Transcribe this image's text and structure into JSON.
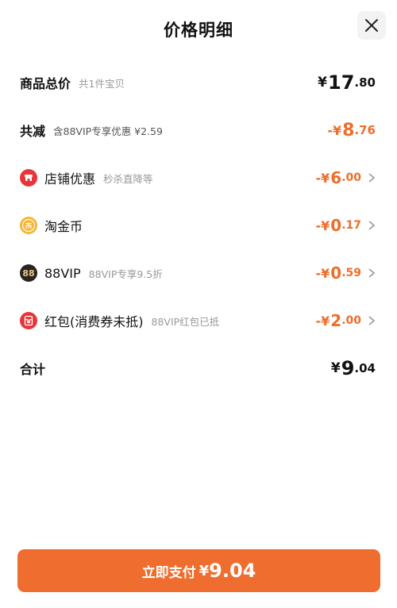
{
  "header": {
    "title": "价格明细",
    "close_icon": "close-icon"
  },
  "rows": {
    "total": {
      "label": "商品总价",
      "hint": "共1件宝贝",
      "currency": "¥",
      "int": "17",
      "dec": ".80"
    },
    "reduce": {
      "label": "共减",
      "hint": "含88VIP专享优惠 ¥2.59",
      "prefix": "-¥",
      "int": "8",
      "dec": ".76"
    },
    "shop": {
      "label": "店铺优惠",
      "hint": "秒杀直降等",
      "prefix": "-¥",
      "int": "6",
      "dec": ".00",
      "icon": "shop-icon"
    },
    "coin": {
      "label": "淘金币",
      "hint": "",
      "prefix": "-¥",
      "int": "0",
      "dec": ".17",
      "icon": "coin-icon"
    },
    "vip": {
      "label": "88VIP",
      "hint": "88VIP专享9.5折",
      "prefix": "-¥",
      "int": "0",
      "dec": ".59",
      "icon": "vip-icon",
      "icon_text": "88"
    },
    "redpacket": {
      "label": "红包(消费券未抵)",
      "hint": "88VIP红包已抵",
      "prefix": "-¥",
      "int": "2",
      "dec": ".00",
      "icon": "red-packet-icon"
    },
    "sum": {
      "label": "合计",
      "currency": "¥",
      "int": "9",
      "dec": ".04"
    }
  },
  "pay_button": {
    "label": "立即支付",
    "currency": "¥",
    "amount": "9.04"
  },
  "colors": {
    "accent": "#ee6d2a",
    "button": "#ef6d2e",
    "shop_icon": "#e8353a",
    "coin_icon": "#f6b431",
    "vip_icon": "#2a2420"
  }
}
